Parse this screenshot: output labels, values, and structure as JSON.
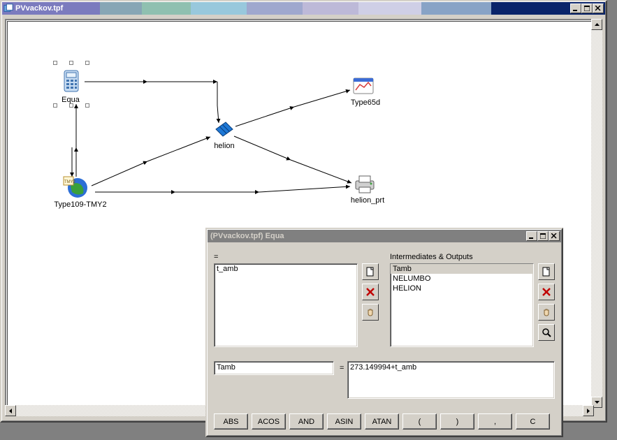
{
  "main_window": {
    "title": "PVvackov.tpf"
  },
  "nodes": {
    "equa": "Equa",
    "type109": "Type109-TMY2",
    "helion": "helion",
    "type65d": "Type65d",
    "helion_prt": "helion_prt"
  },
  "equa_window": {
    "title": "(PVvackov.tpf) Equa",
    "eq_label": "=",
    "inputs_list": [
      "t_amb"
    ],
    "intermediates_label": "Intermediates & Outputs",
    "outputs_list": [
      "Tamb",
      "NELUMBO",
      "HELION"
    ],
    "outputs_selected_index": 0,
    "var_name": "Tamb",
    "expr_label": "=",
    "expr_value": "273.149994+t_amb",
    "fn_buttons": [
      "ABS",
      "ACOS",
      "AND",
      "ASIN",
      "ATAN",
      "(",
      ")",
      ",",
      "C"
    ]
  }
}
